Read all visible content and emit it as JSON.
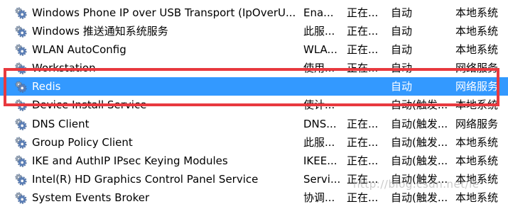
{
  "services": [
    {
      "name": "Windows Phone IP over USB Transport (IpOverU...",
      "description": "Ena...",
      "status": "正在...",
      "startup": "自动",
      "logon": "本地系统",
      "icon": "gear-icon"
    },
    {
      "name": "Windows 推送通知系统服务",
      "description": "此服...",
      "status": "正在...",
      "startup": "自动",
      "logon": "本地系统",
      "icon": "gear-icon"
    },
    {
      "name": "WLAN AutoConfig",
      "description": "WLA...",
      "status": "正在...",
      "startup": "自动",
      "logon": "本地系统",
      "icon": "gear-icon"
    },
    {
      "name": "Workstation",
      "description": "使用...",
      "status": "正在...",
      "startup": "自动",
      "logon": "网络服务",
      "icon": "gear-icon"
    },
    {
      "name": "Redis",
      "description": "",
      "status": "",
      "startup": "自动",
      "logon": "网络服务",
      "icon": "gear-icon",
      "selected": true
    },
    {
      "name": "Device Install Service",
      "description": "使计...",
      "status": "",
      "startup": "自动(触发...",
      "logon": "本地系统",
      "icon": "gear-icon"
    },
    {
      "name": "DNS Client",
      "description": "DNS...",
      "status": "正在...",
      "startup": "自动(触发...",
      "logon": "网络服务",
      "icon": "gear-icon"
    },
    {
      "name": "Group Policy Client",
      "description": "此服...",
      "status": "正在...",
      "startup": "自动(触发...",
      "logon": "本地系统",
      "icon": "gear-icon"
    },
    {
      "name": "IKE and AuthIP IPsec Keying Modules",
      "description": "IKEE...",
      "status": "正在...",
      "startup": "自动(触发...",
      "logon": "本地系统",
      "icon": "gear-icon"
    },
    {
      "name": "Intel(R) HD Graphics Control Panel Service",
      "description": "Servi...",
      "status": "正在...",
      "startup": "自动(触发...",
      "logon": "本地系统",
      "icon": "gear-icon"
    },
    {
      "name": "System Events Broker",
      "description": "协调...",
      "status": "正在...",
      "startup": "自动(触发...",
      "logon": "本地系统",
      "icon": "gear-icon"
    }
  ],
  "watermark": "http://blog.csdn.net/ie",
  "colors": {
    "selection": "#3399ff",
    "highlight_border": "#e8393f",
    "gear_blue": "#5b7fb8",
    "gear_gray": "#9aa3ad"
  }
}
